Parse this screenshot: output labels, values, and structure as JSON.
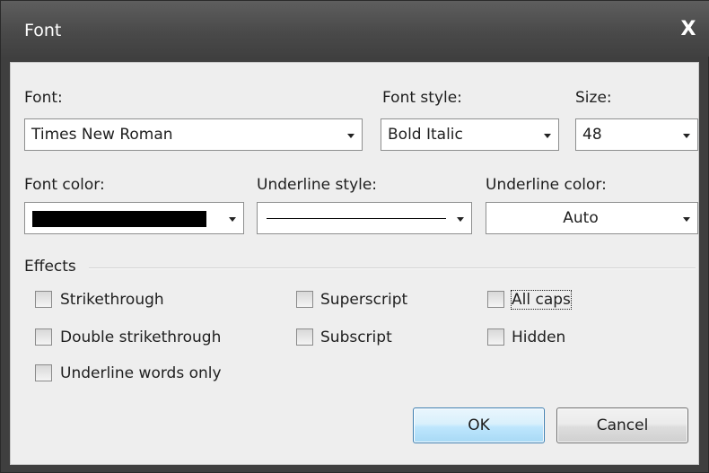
{
  "window": {
    "title": "Font",
    "close_glyph": "X"
  },
  "labels": {
    "font": "Font:",
    "font_style": "Font style:",
    "size": "Size:",
    "font_color": "Font color:",
    "underline_style": "Underline style:",
    "underline_color": "Underline color:",
    "effects": "Effects"
  },
  "fields": {
    "font": "Times New Roman",
    "font_style": "Bold Italic",
    "size": "48",
    "font_color": "#000000",
    "underline_style": "solid",
    "underline_color": "Auto"
  },
  "effects": {
    "strikethrough": {
      "label": "Strikethrough",
      "checked": false
    },
    "double_strikethrough": {
      "label": "Double strikethrough",
      "checked": false
    },
    "underline_words_only": {
      "label": "Underline words only",
      "checked": false
    },
    "superscript": {
      "label": "Superscript",
      "checked": false
    },
    "subscript": {
      "label": "Subscript",
      "checked": false
    },
    "all_caps": {
      "label": "All caps",
      "checked": false
    },
    "hidden": {
      "label": "Hidden",
      "checked": false
    }
  },
  "buttons": {
    "ok": "OK",
    "cancel": "Cancel"
  },
  "colors": {
    "titlebar": "#4a4a4a",
    "dialog_bg": "#eeeeee",
    "ok_border": "#3c7fb1"
  }
}
